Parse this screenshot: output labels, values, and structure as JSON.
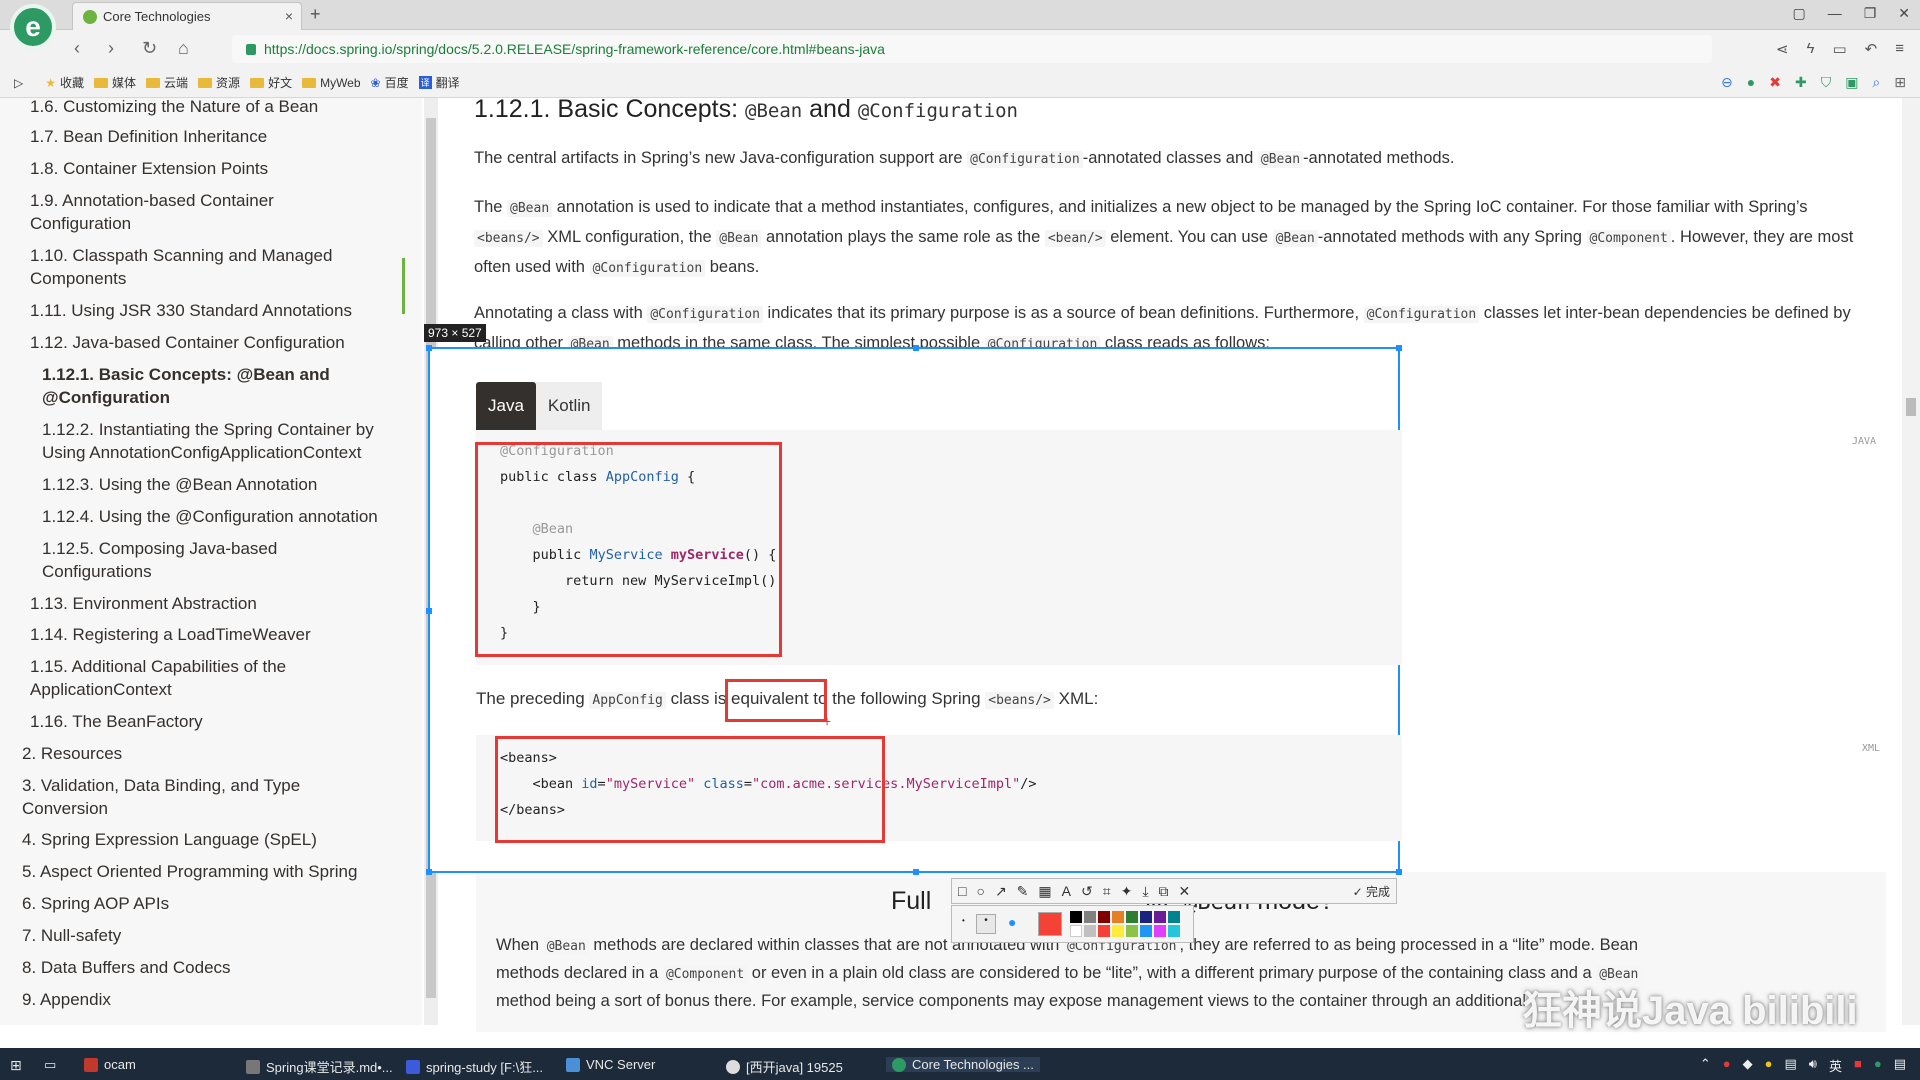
{
  "browser": {
    "tab_title": "Core Technologies",
    "tab_close": "×",
    "new_tab": "+",
    "url": "https://docs.spring.io/spring/docs/5.2.0.RELEASE/spring-framework-reference/core.html#beans-java"
  },
  "bookmarks": [
    "收藏",
    "媒体",
    "云端",
    "资源",
    "好文",
    "MyWeb",
    "百度",
    "翻译"
  ],
  "sidebar": {
    "items": [
      "1.6. Customizing the Nature of a Bean",
      "1.7. Bean Definition Inheritance",
      "1.8. Container Extension Points",
      "1.9. Annotation-based Container Configuration",
      "1.10. Classpath Scanning and Managed Components",
      "1.11. Using JSR 330 Standard Annotations",
      "1.12. Java-based Container Configuration",
      "1.12.1. Basic Concepts: @Bean and @Configuration",
      "1.12.2. Instantiating the Spring Container by Using AnnotationConfigApplicationContext",
      "1.12.3. Using the @Bean Annotation",
      "1.12.4. Using the @Configuration annotation",
      "1.12.5. Composing Java-based Configurations",
      "1.13. Environment Abstraction",
      "1.14. Registering a LoadTimeWeaver",
      "1.15. Additional Capabilities of the ApplicationContext",
      "1.16. The BeanFactory",
      "2. Resources",
      "3. Validation, Data Binding, and Type Conversion",
      "4. Spring Expression Language (SpEL)",
      "5. Aspect Oriented Programming with Spring",
      "6. Spring AOP APIs",
      "7. Null-safety",
      "8. Data Buffers and Codecs",
      "9. Appendix"
    ]
  },
  "main": {
    "heading_prefix": "1.12.1. Basic Concepts:",
    "heading_code1": "@Bean",
    "heading_and": "and",
    "heading_code2": "@Configuration",
    "p1": [
      "The central artifacts in Spring’s new Java-configuration support are ",
      "@Configuration",
      "-annotated classes and ",
      "@Bean",
      "-annotated methods."
    ],
    "p2": [
      "The ",
      "@Bean",
      " annotation is used to indicate that a method instantiates, configures, and initializes a new object to be managed by the Spring IoC container. For those familiar with Spring’s ",
      "<beans/>",
      " XML configuration, the ",
      "@Bean",
      " annotation plays the same role as the ",
      "<bean/>",
      " element. You can use ",
      "@Bean",
      "-annotated methods with any Spring ",
      "@Component",
      ". However, they are most often used with ",
      "@Configuration",
      " beans."
    ],
    "p3": [
      "Annotating a class with ",
      "@Configuration",
      " indicates that its primary purpose is as a source of bean definitions. Furthermore, ",
      "@Configuration",
      " classes let inter-bean dependencies be defined by calling other ",
      "@Bean",
      " methods in the same class. The simplest possible ",
      "@Configuration",
      " class reads as follows:"
    ],
    "tabs": [
      "Java",
      "Kotlin"
    ],
    "code_lang_java": "JAVA",
    "code_lang_xml": "XML",
    "preceding": [
      "The preceding ",
      "AppConfig",
      " class is equivalent to the following Spring ",
      "<beans/>",
      " XML:"
    ],
    "preceding_highlight": "s equivalent",
    "full_title_left": "Full",
    "full_title_mid": "lite",
    "full_title_code": "@Bean",
    "full_title_right": "mode?",
    "lower_p1": [
      "When ",
      "@Bean",
      " methods are declared within classes that are not annotated with ",
      "@Configuration",
      ", they are referred to as being processed in a “lite” mode. Bean"
    ],
    "lower_p2": [
      "methods declared in a ",
      "@Component",
      " or even in a plain old class are considered to be “lite”, with a different primary purpose of the containing class and a ",
      "@Bean"
    ],
    "lower_p3": "method being a sort of bonus there. For example, service components may expose management views to the container through an additional"
  },
  "capture": {
    "size_label": "973 × 527",
    "done_label": "完成"
  },
  "taskbar": {
    "items": [
      "ocam",
      "Spring课堂记录.md•...",
      "spring-study [F:\\狂...",
      "VNC Server",
      "[西开java] 19525",
      "Core Technologies ..."
    ]
  },
  "watermark": "狂神说Java bilibili",
  "colors": {
    "spring_green": "#6db33f",
    "highlight_red": "#e53935",
    "selection_blue": "#1e90ff"
  }
}
